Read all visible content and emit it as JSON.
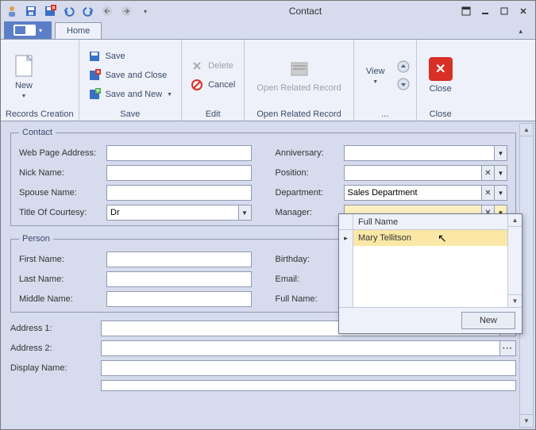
{
  "window": {
    "title": "Contact"
  },
  "ribbon": {
    "tabs": {
      "home": "Home"
    },
    "groups": {
      "records_creation": {
        "label": "Records Creation",
        "new": "New"
      },
      "save": {
        "label": "Save",
        "save": "Save",
        "save_close": "Save and Close",
        "save_new": "Save and New"
      },
      "edit": {
        "label": "Edit",
        "delete": "Delete",
        "cancel": "Cancel"
      },
      "open_related": {
        "label": "Open Related Record",
        "btn": "Open Related Record"
      },
      "view": {
        "label": "...",
        "view": "View"
      },
      "close": {
        "label": "Close",
        "close": "Close"
      }
    }
  },
  "sections": {
    "contact": "Contact",
    "person": "Person"
  },
  "labels": {
    "web_page": "Web Page Address:",
    "nick_name": "Nick Name:",
    "spouse_name": "Spouse Name:",
    "title_courtesy": "Title Of Courtesy:",
    "anniversary": "Anniversary:",
    "position": "Position:",
    "department": "Department:",
    "manager": "Manager:",
    "first_name": "First Name:",
    "last_name": "Last Name:",
    "middle_name": "Middle Name:",
    "birthday": "Birthday:",
    "email": "Email:",
    "full_name": "Full Name:",
    "address1": "Address 1:",
    "address2": "Address 2:",
    "display_name": "Display Name:"
  },
  "values": {
    "web_page": "",
    "nick_name": "",
    "spouse_name": "",
    "title_courtesy": "Dr",
    "anniversary": "",
    "position": "",
    "department": "Sales Department",
    "manager": "",
    "first_name": "",
    "last_name": "",
    "middle_name": "",
    "birthday": "",
    "email": "",
    "full_name": "",
    "address1": "",
    "address2": "",
    "display_name": ""
  },
  "dropdown": {
    "column": "Full Name",
    "rows": [
      "Mary Tellitson"
    ],
    "new_btn": "New"
  }
}
